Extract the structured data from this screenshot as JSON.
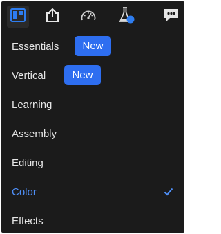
{
  "toolbar": {
    "tools": [
      {
        "icon": "workspaces-icon",
        "active": true
      },
      {
        "icon": "export-icon",
        "active": false
      },
      {
        "icon": "gauge-icon",
        "active": false
      },
      {
        "icon": "flask-icon",
        "active": false
      },
      {
        "icon": "comments-icon",
        "active": false
      }
    ],
    "accent": "#2e6ef0"
  },
  "menu": {
    "items": [
      {
        "label": "Essentials",
        "badge": "New",
        "selected": false
      },
      {
        "label": "Vertical",
        "badge": "New",
        "selected": false
      },
      {
        "label": "Learning",
        "selected": false
      },
      {
        "label": "Assembly",
        "selected": false
      },
      {
        "label": "Editing",
        "selected": false
      },
      {
        "label": "Color",
        "selected": true
      },
      {
        "label": "Effects",
        "selected": false
      }
    ],
    "selected_color": "#4f8ff7",
    "badge_color": "#2e6ef0"
  }
}
